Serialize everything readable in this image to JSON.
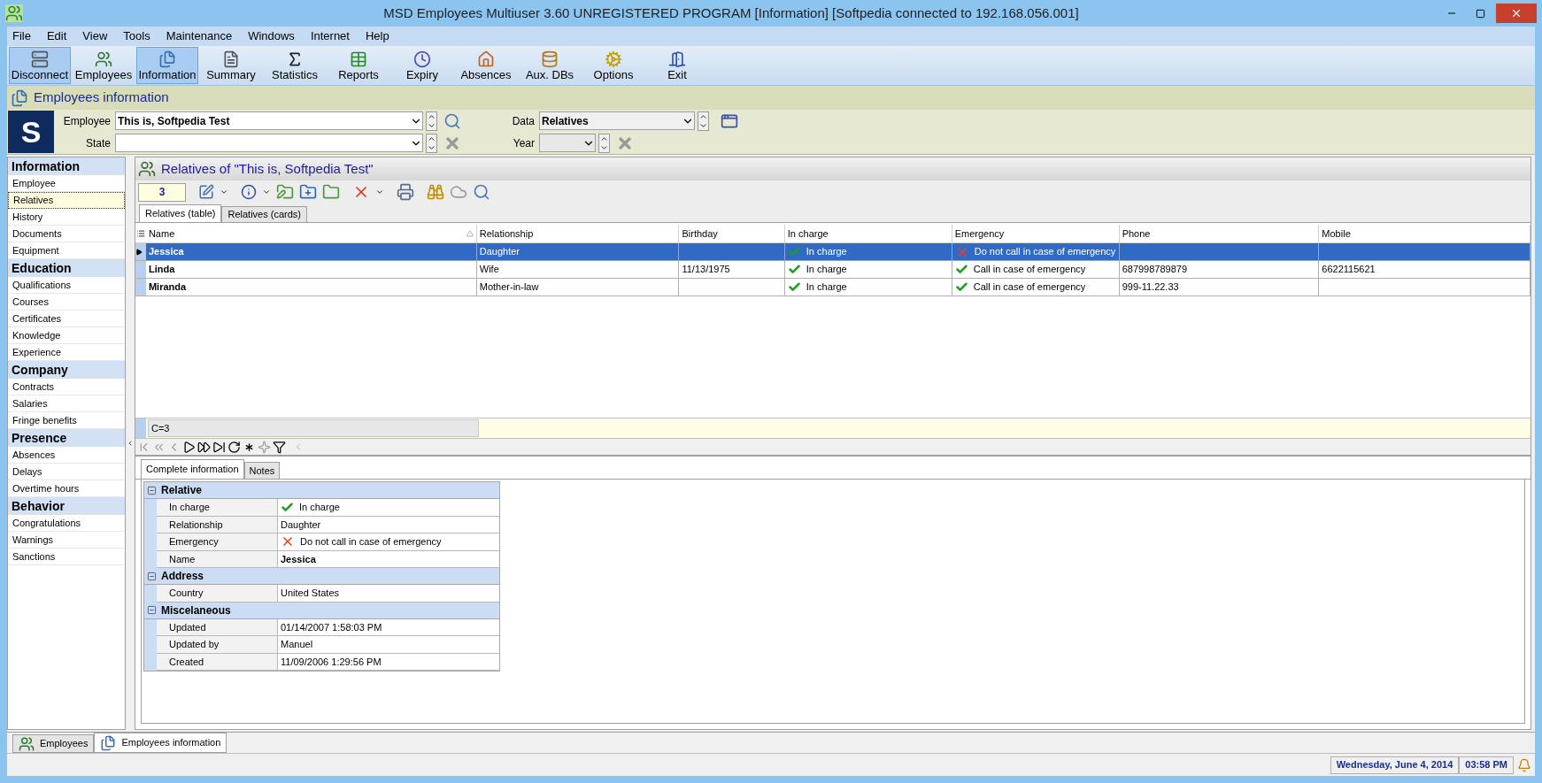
{
  "window": {
    "title": "MSD Employees Multiuser 3.60 UNREGISTERED PROGRAM [Information] [Softpedia connected to 192.168.056.001]"
  },
  "menu": [
    "File",
    "Edit",
    "View",
    "Tools",
    "Maintenance",
    "Windows",
    "Internet",
    "Help"
  ],
  "toolbar": [
    {
      "kind": "disconnect",
      "label": "Disconnect",
      "highlighted": true
    },
    {
      "kind": "employees",
      "label": "Employees",
      "highlighted": false
    },
    {
      "kind": "information",
      "label": "Information",
      "highlighted": true
    },
    {
      "kind": "summary",
      "label": "Summary",
      "highlighted": false
    },
    {
      "kind": "statistics",
      "label": "Statistics",
      "highlighted": false
    },
    {
      "kind": "reports",
      "label": "Reports",
      "highlighted": false
    },
    {
      "kind": "expiry",
      "label": "Expiry",
      "highlighted": false
    },
    {
      "kind": "absences",
      "label": "Absences",
      "highlighted": false
    },
    {
      "kind": "auxdbs",
      "label": "Aux. DBs",
      "highlighted": false
    },
    {
      "kind": "options",
      "label": "Options",
      "highlighted": false
    },
    {
      "kind": "exit",
      "label": "Exit",
      "highlighted": false
    }
  ],
  "section_title": "Employees information",
  "logo": {
    "letter": "S"
  },
  "filters": {
    "employee": {
      "label": "Employee",
      "value": "This is, Softpedia Test"
    },
    "data": {
      "label": "Data",
      "value": "Relatives"
    },
    "state": {
      "label": "State"
    },
    "year": {
      "label": "Year"
    }
  },
  "sidebar": {
    "groups": [
      {
        "title": "Information",
        "items": [
          {
            "label": "Employee",
            "selected": false
          },
          {
            "label": "Relatives",
            "selected": true
          },
          {
            "label": "History",
            "selected": false
          },
          {
            "label": "Documents",
            "selected": false
          },
          {
            "label": "Equipment",
            "selected": false
          }
        ]
      },
      {
        "title": "Education",
        "items": [
          {
            "label": "Qualifications",
            "selected": false
          },
          {
            "label": "Courses",
            "selected": false
          },
          {
            "label": "Certificates",
            "selected": false
          },
          {
            "label": "Knowledge",
            "selected": false
          },
          {
            "label": "Experience",
            "selected": false
          }
        ]
      },
      {
        "title": "Company",
        "items": [
          {
            "label": "Contracts",
            "selected": false
          },
          {
            "label": "Salaries",
            "selected": false
          },
          {
            "label": "Fringe benefits",
            "selected": false
          }
        ]
      },
      {
        "title": "Presence",
        "items": [
          {
            "label": "Absences",
            "selected": false
          },
          {
            "label": "Delays",
            "selected": false
          },
          {
            "label": "Overtime hours",
            "selected": false
          }
        ]
      },
      {
        "title": "Behavior",
        "items": [
          {
            "label": "Congratulations",
            "selected": false
          },
          {
            "label": "Warnings",
            "selected": false
          },
          {
            "label": "Sanctions",
            "selected": false
          }
        ]
      }
    ]
  },
  "panel": {
    "title": "Relatives of \"This is, Softpedia Test\"",
    "counter": "3",
    "tabs": [
      {
        "label": "Relatives (table)",
        "selected": true
      },
      {
        "label": "Relatives (cards)",
        "selected": false
      }
    ],
    "table": {
      "columns": [
        "Name",
        "Relationship",
        "Birthday",
        "In charge",
        "Emergency",
        "Phone",
        "Mobile"
      ],
      "rows": [
        {
          "selected": true,
          "name": "Jessica",
          "relationship": "Daughter",
          "in_charge": {
            "checked": true,
            "text": "In charge"
          },
          "emergency": {
            "checked": false,
            "text": "Do not call in case of emergency"
          }
        },
        {
          "selected": false,
          "name": "Linda",
          "relationship": "Wife",
          "birthday": "11/13/1975",
          "in_charge": {
            "checked": true,
            "text": "In charge"
          },
          "emergency": {
            "checked": true,
            "text": "Call in case of emergency"
          },
          "phone": "687998789879",
          "mobile": "6622115621"
        },
        {
          "selected": false,
          "name": "Miranda",
          "relationship": "Mother-in-law",
          "in_charge": {
            "checked": true,
            "text": "In charge"
          },
          "emergency": {
            "checked": true,
            "text": "Call in case of emergency"
          },
          "phone": "999-11.22.33"
        }
      ]
    },
    "footer": "C=3",
    "detail_tabs": [
      {
        "label": "Complete information",
        "selected": true
      },
      {
        "label": "Notes",
        "selected": false
      }
    ],
    "details": [
      {
        "title": "Relative",
        "expanded": true,
        "rows": [
          {
            "label": "In charge",
            "value": "In charge",
            "checked": true
          },
          {
            "label": "Relationship",
            "value": "Daughter"
          },
          {
            "label": "Emergency",
            "value": "Do not call in case of emergency",
            "checked": false
          },
          {
            "label": "Name",
            "value": "Jessica",
            "bold": true
          }
        ]
      },
      {
        "title": "Address",
        "expanded": true,
        "rows": [
          {
            "label": "Country",
            "value": "United States"
          }
        ]
      },
      {
        "title": "Miscelaneous",
        "expanded": true,
        "rows": [
          {
            "label": "Updated",
            "value": "01/14/2007 1:58:03 PM"
          },
          {
            "label": "Updated by",
            "value": "Manuel"
          },
          {
            "label": "Created",
            "value": "11/09/2006 1:29:56 PM"
          }
        ]
      }
    ]
  },
  "bottom_tabs": [
    {
      "kind": "employees",
      "label": "Employees",
      "selected": false
    },
    {
      "kind": "information",
      "label": "Employees information",
      "selected": true
    }
  ],
  "status_bar": {
    "date": "Wednesday, June 4, 2014",
    "time": "03:58 PM"
  }
}
